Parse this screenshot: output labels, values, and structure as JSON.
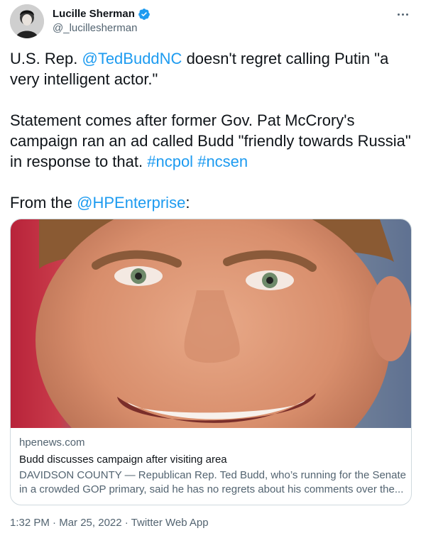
{
  "author": {
    "display_name": "Lucille Sherman",
    "handle": "@_lucillesherman",
    "verified_icon": "verified-badge-icon"
  },
  "tweet": {
    "line1_prefix": "U.S. Rep. ",
    "mention1": "@TedBuddNC",
    "line1_suffix": " doesn't regret calling Putin \"a very intelligent actor.\"",
    "para2_text": "Statement comes after former Gov. Pat McCrory's campaign ran an ad called Budd \"friendly towards Russia\" in response to that. ",
    "hashtag1": "#ncpol",
    "hashtag2": "#ncsen",
    "para3_prefix": "From the ",
    "mention2": "@HPEnterprise",
    "para3_suffix": ":"
  },
  "card": {
    "domain": "hpenews.com",
    "title": "Budd discusses campaign after visiting area",
    "description": "DAVIDSON COUNTY — Republican Rep. Ted Budd, who’s running for the Senate in a crowded GOP primary, said he has no regrets about his comments over the..."
  },
  "footer": {
    "time": "1:32 PM",
    "separator": " · ",
    "date": "Mar 25, 2022",
    "source": "Twitter Web App"
  },
  "colors": {
    "link": "#1d9bf0",
    "secondary_text": "#536471",
    "primary_text": "#0f1419",
    "border": "#cfd9de"
  }
}
